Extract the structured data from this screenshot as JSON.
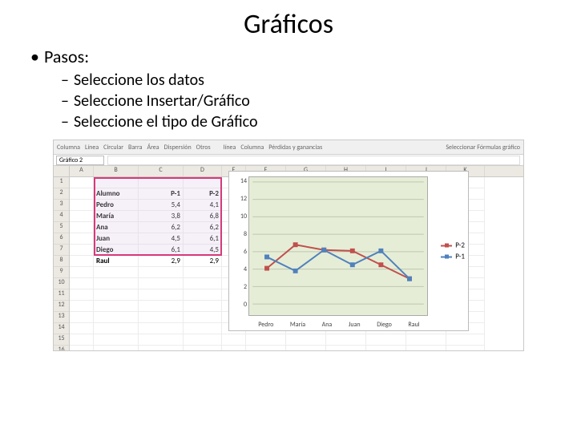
{
  "title": "Gráficos",
  "steps_label": "Pasos:",
  "steps": [
    "Seleccione los datos",
    "Seleccione Insertar/Gráfico",
    "Seleccione el tipo de Gráfico"
  ],
  "ribbon": [
    "Columna",
    "Línea",
    "Circular",
    "Barra",
    "Área",
    "Dispersión",
    "Otros",
    "línea",
    "Columna",
    "Pérdidas y ganancias",
    "Seleccionar Fórmulas gráfico"
  ],
  "namebox": "Gráfico 2",
  "columns": [
    "A",
    "B",
    "C",
    "D",
    "E",
    "F",
    "G",
    "H",
    "I",
    "J",
    "K"
  ],
  "row_count": 17,
  "table": {
    "headers": [
      "Alumno",
      "P-1",
      "P-2"
    ],
    "rows": [
      {
        "name": "Pedro",
        "p1": "5,4",
        "p2": "4,1"
      },
      {
        "name": "María",
        "p1": "3,8",
        "p2": "6,8"
      },
      {
        "name": "Ana",
        "p1": "6,2",
        "p2": "6,2"
      },
      {
        "name": "Juan",
        "p1": "4,5",
        "p2": "6,1"
      },
      {
        "name": "Diego",
        "p1": "6,1",
        "p2": "4,5"
      },
      {
        "name": "Raul",
        "p1": "2,9",
        "p2": "2,9"
      }
    ]
  },
  "chart_data": {
    "type": "line",
    "categories": [
      "Pedro",
      "María",
      "Ana",
      "Juan",
      "Diego",
      "Raul"
    ],
    "series": [
      {
        "name": "P-2",
        "values": [
          4.1,
          6.8,
          6.2,
          6.1,
          4.5,
          2.9
        ],
        "color": "#c0504d"
      },
      {
        "name": "P-1",
        "values": [
          5.4,
          3.8,
          6.2,
          4.5,
          6.1,
          2.9
        ],
        "color": "#4f81bd"
      }
    ],
    "ylim": [
      0,
      14
    ],
    "yticks": [
      0,
      2,
      4,
      6,
      8,
      10,
      12,
      14
    ],
    "plot_bg": "#e6edd6"
  },
  "legend": [
    {
      "label": "P-2",
      "color": "#c0504d"
    },
    {
      "label": "P-1",
      "color": "#4f81bd"
    }
  ]
}
